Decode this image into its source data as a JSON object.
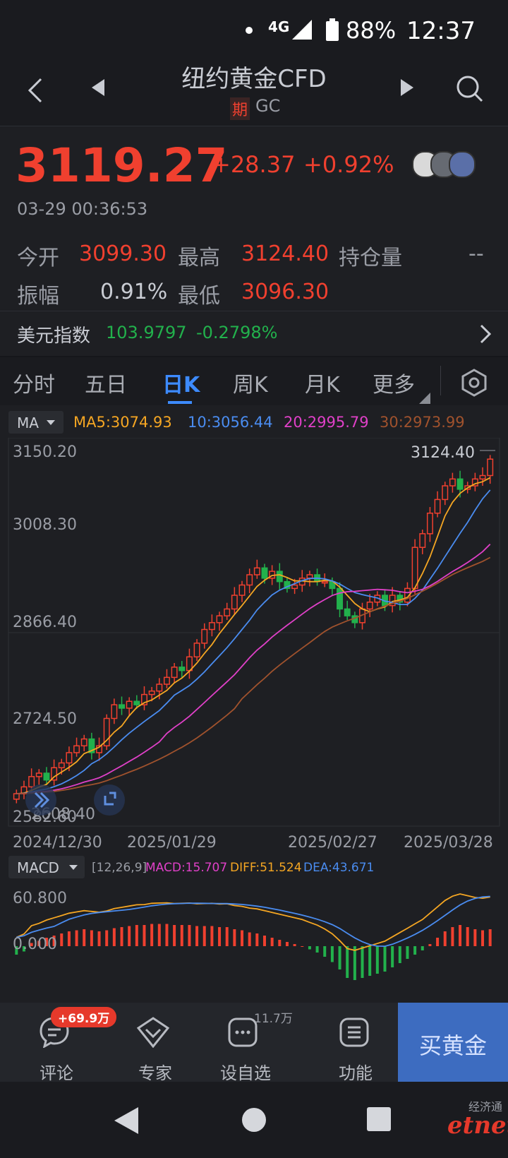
{
  "status": {
    "network": "4G",
    "battery": "88%",
    "time": "12:37"
  },
  "header": {
    "title": "纽约黄金CFD",
    "tag": "期",
    "code": "GC"
  },
  "quote": {
    "price": "3119.27",
    "change": "+28.37",
    "change_pct": "+0.92%",
    "timestamp": "03-29 00:36:53"
  },
  "stats": {
    "open_label": "今开",
    "open": "3099.30",
    "high_label": "最高",
    "high": "3124.40",
    "oi_label": "持仓量",
    "oi": "--",
    "amp_label": "振幅",
    "amp": "0.91%",
    "low_label": "最低",
    "low": "3096.30"
  },
  "usd_index": {
    "label": "美元指数",
    "value": "103.9797",
    "change": "-0.2798%"
  },
  "tabs": [
    "分时",
    "五日",
    "日K",
    "周K",
    "月K",
    "更多"
  ],
  "active_tab": "日K",
  "ma_bar": {
    "selector": "MA",
    "ma5": "MA5:3074.93",
    "ma10": "10:3056.44",
    "ma20": "20:2995.79",
    "ma30": "30:2973.99"
  },
  "main_chart": {
    "y_labels": [
      "3150.20",
      "3008.30",
      "2866.40",
      "2724.50",
      "2582.60"
    ],
    "overlap_label": "2608.40",
    "max_label": "3124.40",
    "x_labels": [
      "2024/12/30",
      "2025/01/29",
      "2025/02/27",
      "2025/03/28"
    ]
  },
  "macd_bar": {
    "selector": "MACD",
    "params": "[12,26,9]",
    "macd": "MACD:15.707",
    "diff": "DIFF:51.524",
    "dea": "DEA:43.671"
  },
  "macd_chart": {
    "y_labels": [
      "60.800",
      "0.000"
    ]
  },
  "bottom_nav": {
    "comment": "评论",
    "comment_badge": "+69.9万",
    "expert": "专家",
    "watch": "设自选",
    "watch_count": "11.7万",
    "func": "功能",
    "buy": "买黄金"
  },
  "watermark": {
    "top": "经济通",
    "bottom": "etnet"
  },
  "colors": {
    "up": "#f0402f",
    "down": "#22b14c",
    "ma5": "#f5a623",
    "ma10": "#4a8cf0",
    "ma20": "#e040c8",
    "ma30": "#a0522d",
    "accent": "#3d8bff",
    "buy_bg": "#3d6cc0"
  },
  "chart_data": [
    {
      "type": "candlestick",
      "title": "纽约黄金CFD 日K",
      "x_axis_labels": [
        "2024/12/30",
        "2025/01/29",
        "2025/02/27",
        "2025/03/28"
      ],
      "ylim": [
        2582.6,
        3150.2
      ],
      "last": {
        "open": 3099.3,
        "high": 3124.4,
        "low": 3096.3,
        "close": 3119.27
      },
      "series": [
        {
          "name": "MA5",
          "last": 3074.93
        },
        {
          "name": "MA10",
          "last": 3056.44
        },
        {
          "name": "MA20",
          "last": 2995.79
        },
        {
          "name": "MA30",
          "last": 2973.99
        }
      ],
      "close_path": [
        2630,
        2640,
        2655,
        2660,
        2650,
        2668,
        2675,
        2690,
        2700,
        2710,
        2690,
        2700,
        2740,
        2760,
        2755,
        2765,
        2760,
        2775,
        2780,
        2790,
        2800,
        2815,
        2810,
        2830,
        2850,
        2870,
        2880,
        2890,
        2900,
        2920,
        2935,
        2950,
        2960,
        2945,
        2955,
        2940,
        2930,
        2935,
        2945,
        2950,
        2940,
        2940,
        2930,
        2900,
        2890,
        2880,
        2900,
        2910,
        2920,
        2905,
        2920,
        2910,
        2930,
        2990,
        3010,
        3040,
        3060,
        3080,
        3090,
        3075,
        3080,
        3090,
        3095,
        3119
      ]
    },
    {
      "type": "bar",
      "title": "MACD",
      "params": "[12,26,9]",
      "ylim": [
        -40,
        70
      ],
      "series": [
        {
          "name": "MACD",
          "last": 15.707
        },
        {
          "name": "DIFF",
          "last": 51.524
        },
        {
          "name": "DEA",
          "last": 43.671
        }
      ],
      "hist": [
        -8,
        -5,
        3,
        5,
        8,
        10,
        12,
        14,
        15,
        16,
        15,
        14,
        15,
        17,
        18,
        19,
        20,
        20,
        21,
        21,
        21,
        20,
        20,
        20,
        19,
        19,
        19,
        18,
        18,
        16,
        15,
        13,
        12,
        10,
        8,
        6,
        4,
        2,
        0,
        -3,
        -6,
        -10,
        -15,
        -22,
        -30,
        -32,
        -30,
        -28,
        -26,
        -24,
        -20,
        -16,
        -12,
        -8,
        -4,
        2,
        8,
        14,
        18,
        20,
        18,
        16,
        15,
        16
      ]
    }
  ]
}
